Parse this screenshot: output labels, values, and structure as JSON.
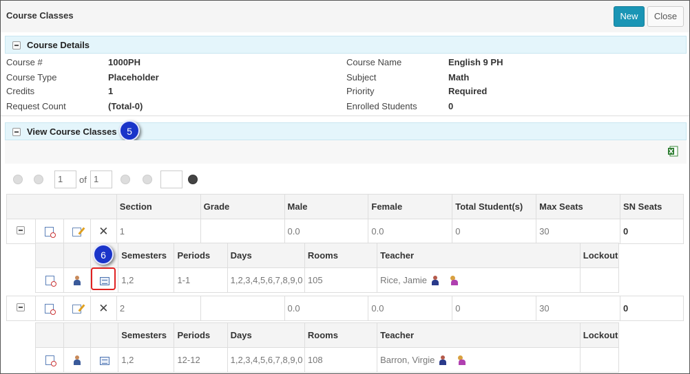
{
  "header": {
    "title": "Course Classes",
    "new_label": "New",
    "close_label": "Close"
  },
  "course_details": {
    "title": "Course Details",
    "left": [
      {
        "label": "Course #",
        "value": "1000PH"
      },
      {
        "label": "Course Type",
        "value": "Placeholder"
      },
      {
        "label": "Credits",
        "value": "1"
      },
      {
        "label": "Request Count",
        "value": "(Total-0)"
      }
    ],
    "right": [
      {
        "label": "Course Name",
        "value": "English 9 PH"
      },
      {
        "label": "Subject",
        "value": "Math"
      },
      {
        "label": "Priority",
        "value": "Required"
      },
      {
        "label": "Enrolled Students",
        "value": "0"
      }
    ]
  },
  "view_classes": {
    "title": "View Course Classes"
  },
  "callouts": {
    "step5": "5",
    "step6": "6"
  },
  "pager": {
    "page": "1",
    "of_label": "of",
    "total_pages": "1",
    "page_size": ""
  },
  "table": {
    "columns": [
      "Section",
      "Grade",
      "Male",
      "Female",
      "Total Student(s)",
      "Max Seats",
      "SN Seats"
    ],
    "rows": [
      {
        "section": "1",
        "grade": "",
        "male": "0.0",
        "female": "0.0",
        "total": "0",
        "max_seats": "30",
        "sn_seats": "0",
        "schedule": {
          "semesters": "1,2",
          "periods": "1-1",
          "days": "1,2,3,4,5,6,7,8,9,0",
          "rooms": "105",
          "teacher": "Rice, Jamie",
          "lockout": ""
        }
      },
      {
        "section": "2",
        "grade": "",
        "male": "0.0",
        "female": "0.0",
        "total": "0",
        "max_seats": "30",
        "sn_seats": "0",
        "schedule": {
          "semesters": "1,2",
          "periods": "12-12",
          "days": "1,2,3,4,5,6,7,8,9,0",
          "rooms": "108",
          "teacher": "Barron, Virgie",
          "lockout": ""
        }
      }
    ],
    "sub_columns": [
      "Semesters",
      "Periods",
      "Days",
      "Rooms",
      "Teacher",
      "Lockout"
    ]
  },
  "colors": {
    "primary_button": "#1a95b5",
    "section_header_bg": "#e4f5fb",
    "callout": "#1a34c9",
    "highlight": "#e02020"
  }
}
